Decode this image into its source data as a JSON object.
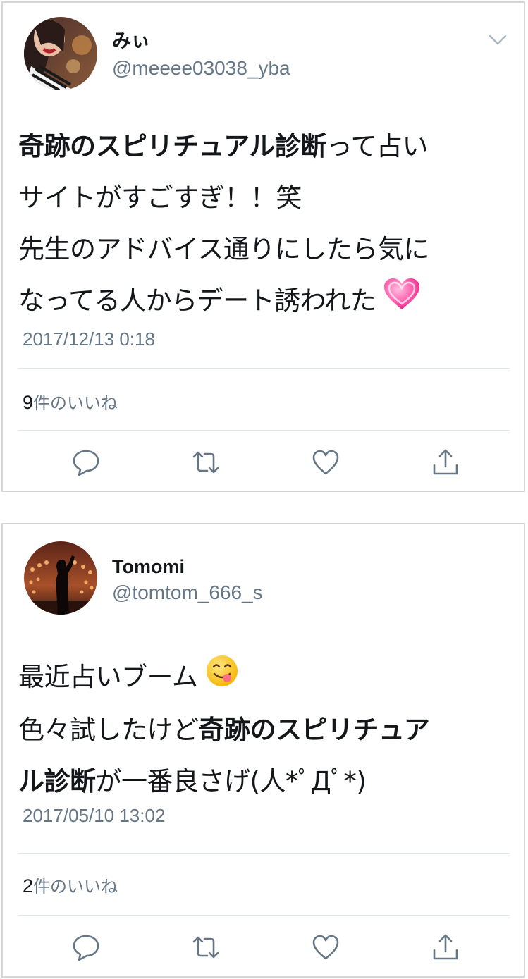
{
  "tweets": [
    {
      "name": "みぃ",
      "handle": "@meeee03038_yba",
      "text_lines": [
        {
          "bold": "奇跡のスピリチュアル診断",
          "normal": "って占い"
        },
        {
          "bold": "",
          "normal": "サイトがすごすぎ！！笑"
        },
        {
          "bold": "",
          "normal": "先生のアドバイス通りにしたら気に"
        },
        {
          "bold": "",
          "normal": "なってる人からデート誘われた"
        }
      ],
      "emoji": "heart-emoji",
      "timestamp": "2017/12/13 0:18",
      "likes_count": "9",
      "likes_label": "件のいいね"
    },
    {
      "name": "Tomomi",
      "handle": "@tomtom_666_s",
      "text_lines": [
        {
          "before": "最近占いブーム",
          "bold": "",
          "after": ""
        },
        {
          "before": "色々試したけど",
          "bold": "奇跡のスピリチュア",
          "after": ""
        },
        {
          "before": "",
          "bold": "ル診断",
          "after": "が一番良さげ(人*ﾟДﾟ*)"
        }
      ],
      "emoji": "savoring-face-emoji",
      "timestamp": "2017/05/10 13:02",
      "likes_count": "2",
      "likes_label": "件のいいね"
    }
  ],
  "colors": {
    "text": "#14171a",
    "secondary": "#657786",
    "divider": "#e1e8ed",
    "icon": "#657786"
  },
  "icons": [
    "reply-icon",
    "retweet-icon",
    "like-icon",
    "share-icon",
    "chevron-down-icon"
  ]
}
